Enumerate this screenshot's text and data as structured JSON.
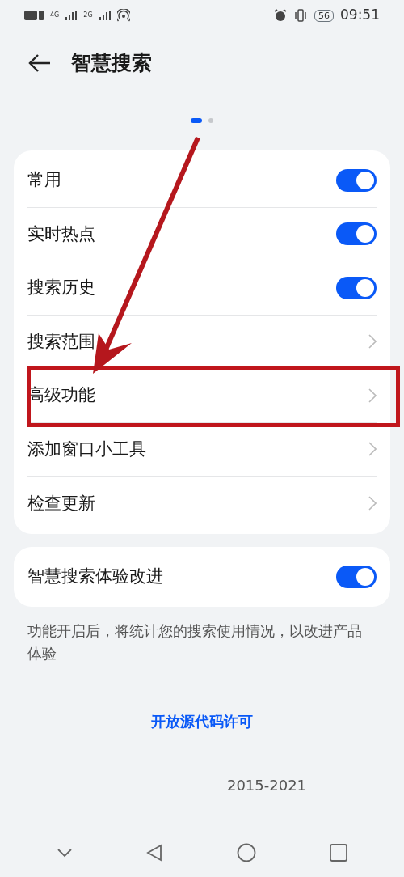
{
  "status_bar": {
    "network_1": "4G",
    "network_2": "2G",
    "battery": "56",
    "time": "09:51"
  },
  "header": {
    "title": "智慧搜索"
  },
  "pager": [
    {
      "selected": true
    },
    {
      "selected": false
    }
  ],
  "settings": [
    {
      "label": "常用",
      "kind": "toggle",
      "on": true
    },
    {
      "label": "实时热点",
      "kind": "toggle",
      "on": true
    },
    {
      "label": "搜索历史",
      "kind": "toggle",
      "on": true
    },
    {
      "label": "搜索范围",
      "kind": "link"
    },
    {
      "label": "高级功能",
      "kind": "link",
      "highlighted": true
    },
    {
      "label": "添加窗口小工具",
      "kind": "link"
    },
    {
      "label": "检查更新",
      "kind": "link"
    }
  ],
  "improvement": {
    "label": "智慧搜索体验改进",
    "on": true,
    "description": "功能开启后，将统计您的搜索使用情况，以改进产品体验"
  },
  "footer": {
    "link": "开放源代码许可",
    "copyright": "2015-2021"
  },
  "annotation": {
    "arrow": true
  }
}
